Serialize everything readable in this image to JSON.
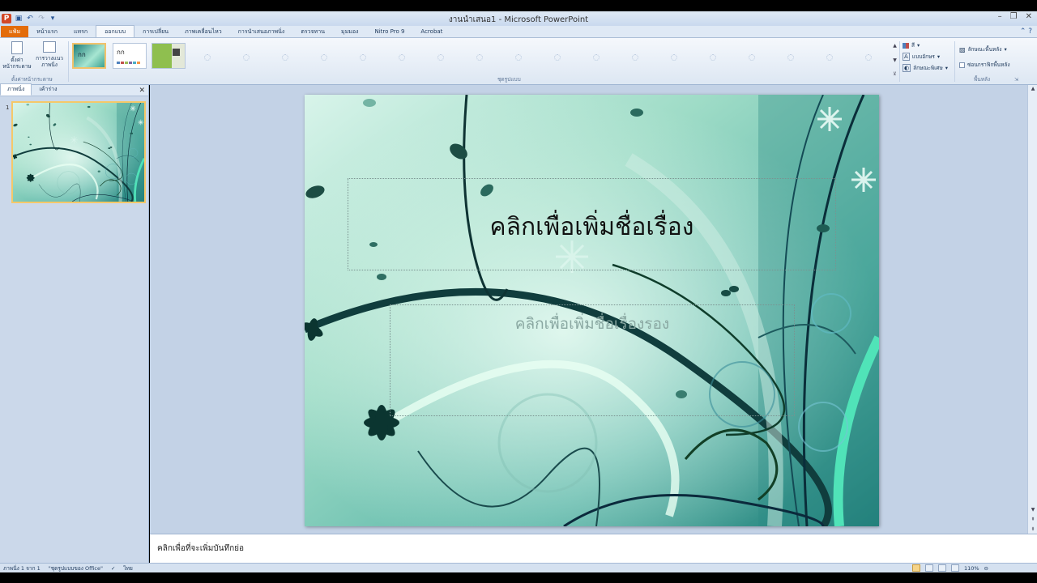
{
  "window": {
    "title": "งานนำเสนอ1 - Microsoft PowerPoint",
    "minimize": "–",
    "restore": "❐",
    "close": "✕"
  },
  "qat": {
    "logo": "P",
    "save_icon": "save-icon",
    "undo_icon": "undo-icon",
    "redo_icon": "redo-icon",
    "customize_icon": "dropdown-icon"
  },
  "tabs": [
    {
      "label": "แฟ้ม"
    },
    {
      "label": "หน้าแรก"
    },
    {
      "label": "แทรก"
    },
    {
      "label": "ออกแบบ"
    },
    {
      "label": "การเปลี่ยน"
    },
    {
      "label": "ภาพเคลื่อนไหว"
    },
    {
      "label": "การนำเสนอภาพนิ่ง"
    },
    {
      "label": "ตรวจทาน"
    },
    {
      "label": "มุมมอง"
    },
    {
      "label": "Nitro Pro 9"
    },
    {
      "label": "Acrobat"
    }
  ],
  "ribbon": {
    "page_setup": {
      "btn1": "ตั้งค่า\nหน้ากระดาษ",
      "btn2": "การวางแนว\nภาพนิ่ง",
      "group": "ตั้งค่าหน้ากระดาษ"
    },
    "themes_group": "ชุดรูปแบบ",
    "theme2_label": "กก",
    "theme1_label": "กก",
    "colors": "สี",
    "fonts": "แบบอักษร",
    "effects": "ลักษณะพิเศษ",
    "background_styles": "ลักษณะพื้นหลัง",
    "hide_bg": "ซ่อนกราฟิกพื้นหลัง",
    "background_group": "พื้นหลัง"
  },
  "left_panel": {
    "tab_slides": "ภาพนิ่ง",
    "tab_outline": "เค้าร่าง",
    "close": "✕",
    "slide_number": "1"
  },
  "slide": {
    "title_placeholder": "คลิกเพื่อเพิ่มชื่อเรื่อง",
    "subtitle_placeholder": "คลิกเพื่อเพิ่มชื่อเรื่องรอง"
  },
  "notes": {
    "placeholder": "คลิกเพื่อที่จะเพิ่มบันทึกย่อ"
  },
  "status": {
    "slide_info": "ภาพนิ่ง 1 จาก 1",
    "theme": "\"ชุดรูปแบบของ Office\"",
    "language": "ไทย",
    "zoom": "110%"
  },
  "colors": {
    "file_tab": "#e36c0a",
    "accent": "#2b5797",
    "slide_bg": "#8fd6c3"
  }
}
